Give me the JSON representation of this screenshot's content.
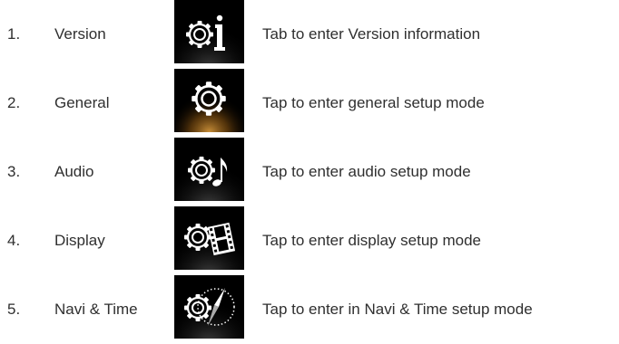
{
  "items": [
    {
      "number": "1.",
      "name": "Version",
      "description": "Tab to enter Version information",
      "icon": "gear-info-icon"
    },
    {
      "number": "2.",
      "name": "General",
      "description": "Tap to enter general setup mode",
      "icon": "gear-icon"
    },
    {
      "number": "3.",
      "name": "Audio",
      "description": "Tap to enter audio setup mode",
      "icon": "gear-music-note-icon"
    },
    {
      "number": "4.",
      "name": "Display",
      "description": "Tap to enter display setup mode",
      "icon": "gear-film-icon"
    },
    {
      "number": "5.",
      "name": "Navi & Time",
      "description": "Tap to enter in Navi & Time setup mode",
      "icon": "gear-compass-icon"
    }
  ],
  "colors": {
    "text": "#2f2f2f",
    "icon_background": "#000000",
    "icon_foreground": "#ffffff",
    "general_glow": "#c8862a"
  }
}
